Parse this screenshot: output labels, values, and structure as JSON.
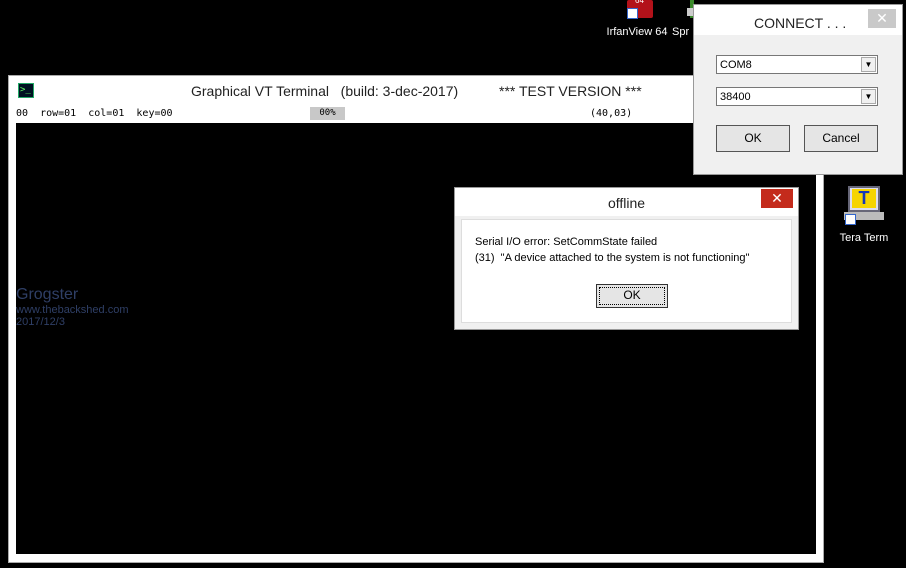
{
  "desktop": {
    "icons": [
      {
        "label": "IrfanView 64",
        "badge": "64"
      },
      {
        "label": "Spr"
      },
      {
        "label": "Tera Term",
        "glyph": "T"
      }
    ]
  },
  "terminal": {
    "title": "Graphical VT Terminal   (build: 3-dec-2017)",
    "test_label": "*** TEST VERSION ***",
    "status_left": "00  row=01  col=01  key=00",
    "progress": "00%",
    "coords": "(40,03)",
    "icon_glyph": ">_",
    "watermark": {
      "name": "Grogster",
      "url": "www.thebackshed.com",
      "date": "2017/12/3"
    }
  },
  "offline_dialog": {
    "title": "offline",
    "close": "✕",
    "message1": "Serial I/O error: SetCommState failed",
    "message2": "(31)  \"A device attached to the system is not functioning\"",
    "ok_label": "OK"
  },
  "connect_dialog": {
    "title": "CONNECT . . .",
    "close": "✕",
    "port": "COM8",
    "baud": "38400",
    "dropdown_arrow": "▼",
    "ok_label": "OK",
    "cancel_label": "Cancel"
  },
  "colors": {
    "close_active": "#c42b1c",
    "desktop": "#000000"
  }
}
